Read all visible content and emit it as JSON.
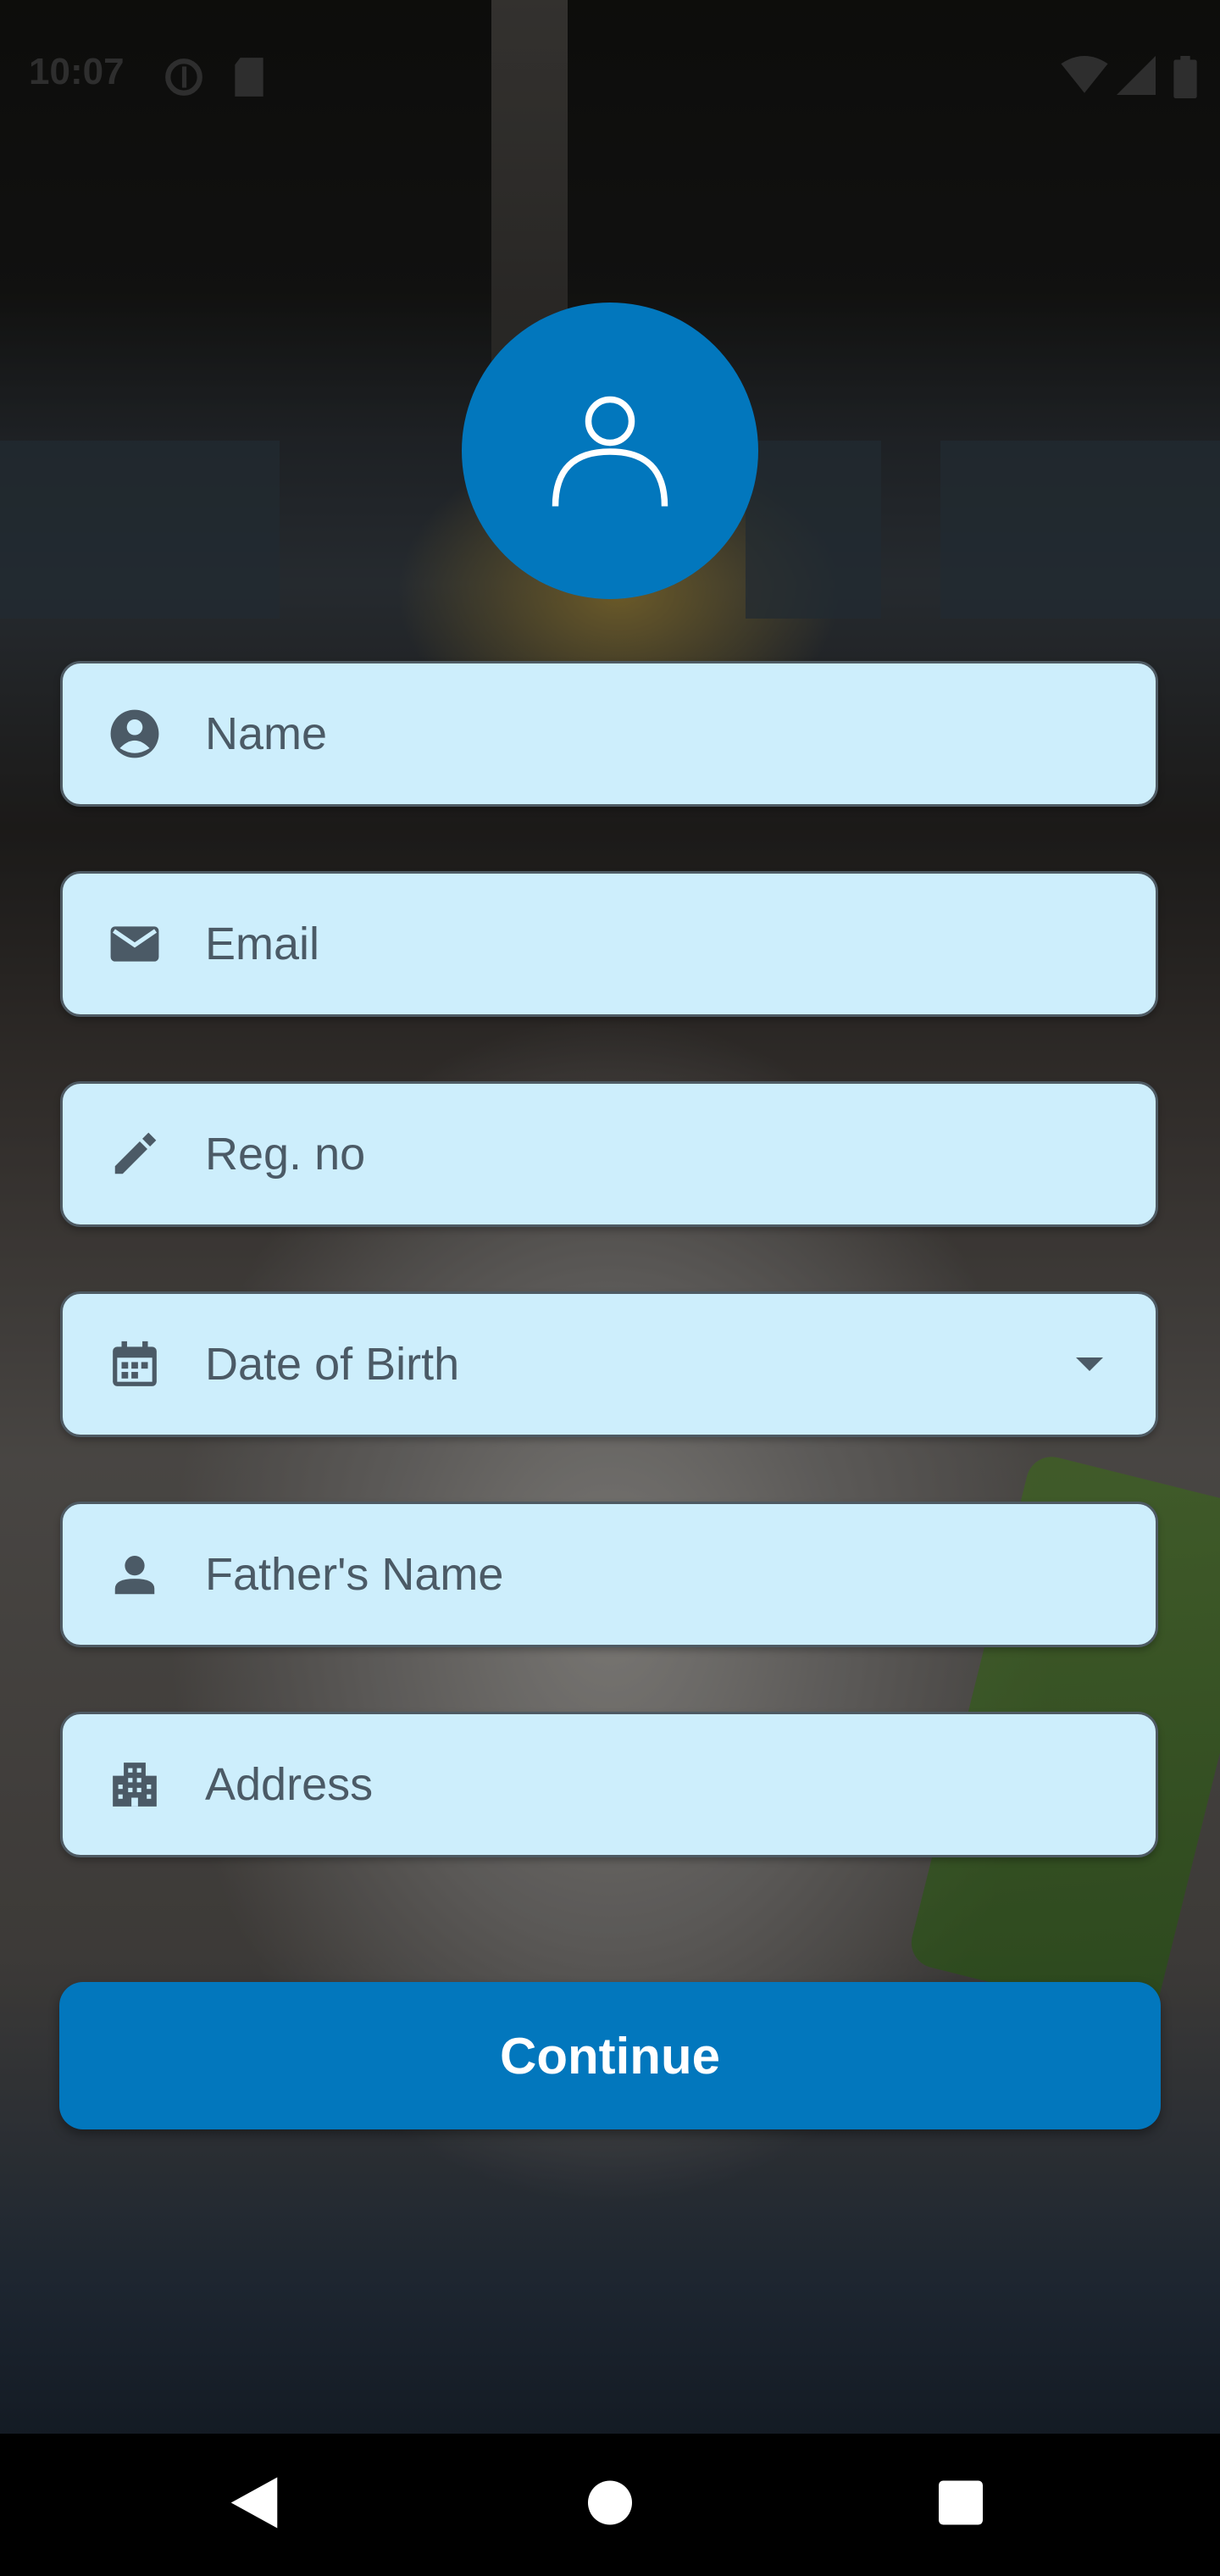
{
  "status_bar": {
    "time": "10:07",
    "icons": [
      "data-saver-icon",
      "sd-card-icon",
      "wifi-icon",
      "signal-icon",
      "battery-icon"
    ]
  },
  "avatar": {
    "icon": "person-outline-icon",
    "color": "#0277bd"
  },
  "form": {
    "fields": [
      {
        "label": "Name",
        "icon": "account-circle-icon"
      },
      {
        "label": "Email",
        "icon": "mail-icon"
      },
      {
        "label": "Reg. no",
        "icon": "pencil-icon"
      },
      {
        "label": "Date of Birth",
        "icon": "calendar-icon",
        "dropdown": true
      },
      {
        "label": "Father's Name",
        "icon": "person-icon"
      },
      {
        "label": "Address",
        "icon": "apartment-icon"
      }
    ],
    "field_background": "#cdeefc",
    "label_color": "#4b5a66"
  },
  "continue_button": {
    "label": "Continue",
    "color": "#0277bd"
  },
  "nav_bar": {
    "buttons": [
      "back-icon",
      "home-icon",
      "recents-icon"
    ]
  }
}
